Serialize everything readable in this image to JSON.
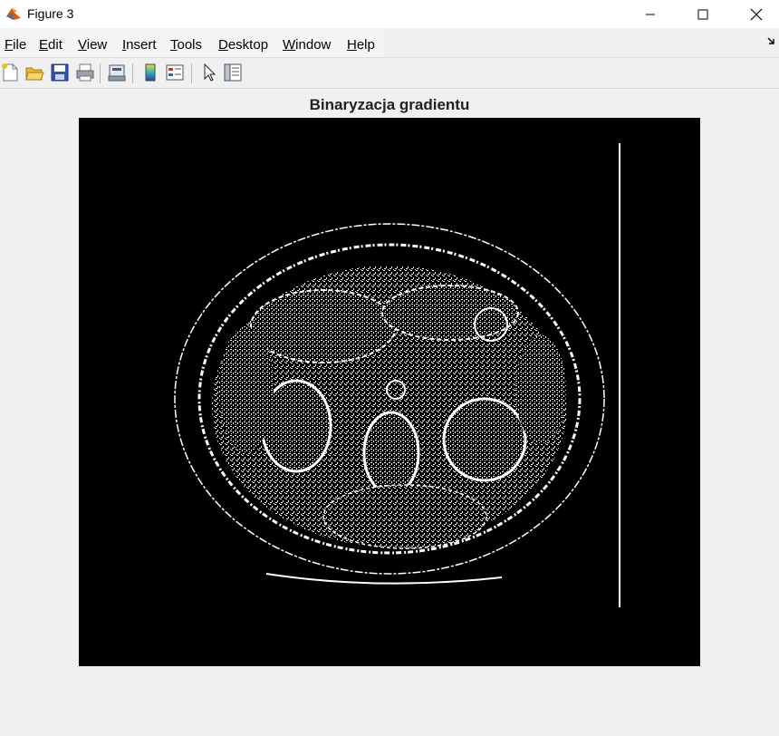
{
  "window": {
    "title": "Figure 3",
    "minimize_glyph": "—",
    "maximize_glyph": "☐",
    "close_glyph": "✕"
  },
  "menu": [
    {
      "label_acc": "F",
      "label_rest": "ile"
    },
    {
      "label_acc": "E",
      "label_rest": "dit"
    },
    {
      "label_acc": "V",
      "label_rest": "iew"
    },
    {
      "label_acc": "I",
      "label_rest": "nsert"
    },
    {
      "label_acc": "T",
      "label_rest": "ools"
    },
    {
      "label_acc": "D",
      "label_rest": "esktop"
    },
    {
      "label_acc": "W",
      "label_rest": "indow"
    },
    {
      "label_acc": "H",
      "label_rest": "elp"
    }
  ],
  "toolbar_icons": [
    "new-figure-icon",
    "open-file-icon",
    "save-icon",
    "print-icon",
    "print-preview-icon",
    "colorbar-icon",
    "legend-icon",
    "edit-plot-icon",
    "property-inspector-icon"
  ],
  "figure": {
    "title": "Binaryzacja gradientu",
    "image_description_colors": {
      "background": "#000000",
      "foreground": "#ffffff"
    }
  }
}
